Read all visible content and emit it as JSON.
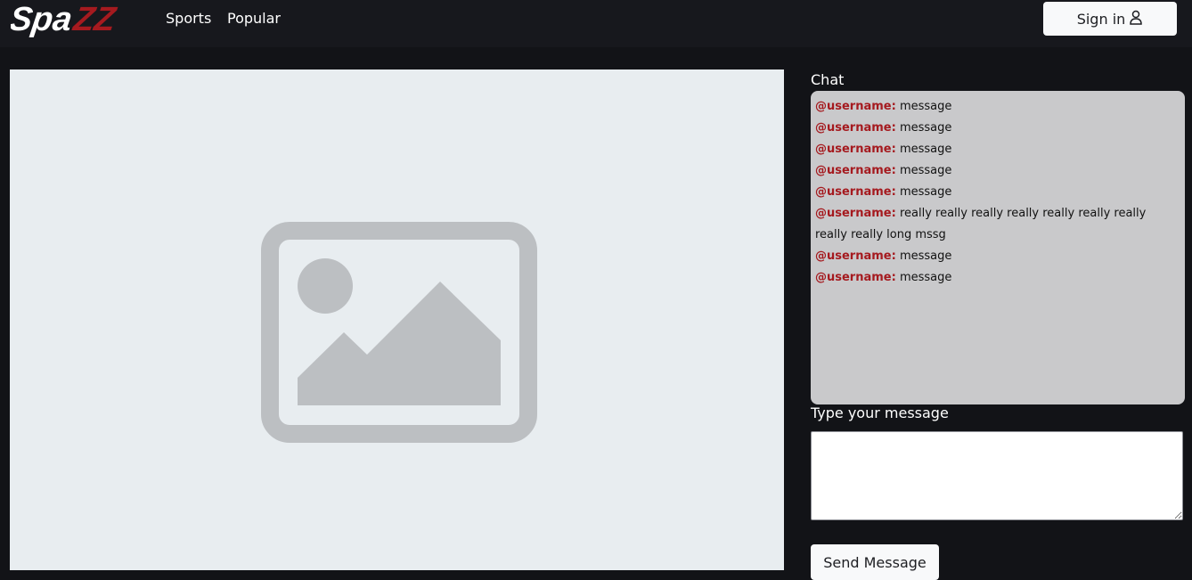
{
  "navbar": {
    "logo_text": "SpaZZ",
    "links": [
      {
        "label": "Sports"
      },
      {
        "label": "Popular"
      }
    ],
    "signin_label": "Sign in",
    "icons": {
      "signin": "user-icon"
    }
  },
  "player": {
    "icon": "image-placeholder-icon"
  },
  "chat": {
    "title": "Chat",
    "messages": [
      {
        "user": "@username:",
        "text": "message"
      },
      {
        "user": "@username:",
        "text": "message"
      },
      {
        "user": "@username:",
        "text": "message"
      },
      {
        "user": "@username:",
        "text": "message"
      },
      {
        "user": "@username:",
        "text": "message"
      },
      {
        "user": "@username:",
        "text": "really really really really really really really really really long mssg"
      },
      {
        "user": "@username:",
        "text": "message"
      },
      {
        "user": "@username:",
        "text": "message"
      }
    ],
    "input_label": "Type your message",
    "input_value": "",
    "send_label": "Send Message"
  },
  "colors": {
    "background": "#121317",
    "navbar": "#17181d",
    "accent_red": "#a51a1f",
    "chat_bg": "#c9c9cb",
    "video_bg": "#e8edf0"
  }
}
